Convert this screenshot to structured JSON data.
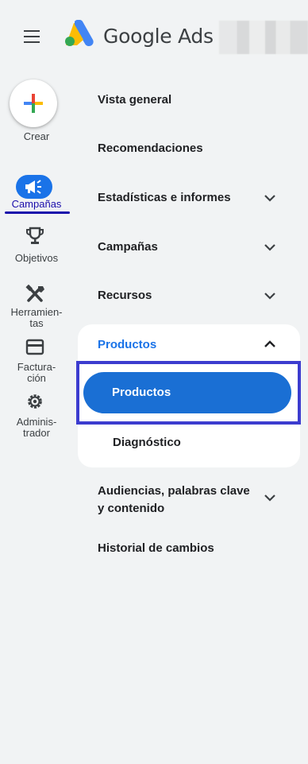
{
  "header": {
    "brand": "Google Ads"
  },
  "rail": {
    "create_label": "Crear",
    "items": [
      {
        "label": "Campañas",
        "icon": "megaphone-icon",
        "active": true
      },
      {
        "label": "Objetivos",
        "icon": "trophy-icon"
      },
      {
        "label_line1": "Herramien-",
        "label_line2": "tas",
        "icon": "tools-icon"
      },
      {
        "label_line1": "Factura-",
        "label_line2": "ción",
        "icon": "credit-card-icon"
      },
      {
        "label_line1": "Adminis-",
        "label_line2": "trador",
        "icon": "gear-icon"
      }
    ]
  },
  "menu": {
    "items": [
      {
        "label": "Vista general"
      },
      {
        "label": "Recomendaciones"
      },
      {
        "label": "Estadísticas e informes",
        "expandable": true
      },
      {
        "label": "Campañas",
        "expandable": true
      },
      {
        "label": "Recursos",
        "expandable": true
      },
      {
        "label": "Productos",
        "expanded": true,
        "children": [
          {
            "label": "Productos",
            "selected": true
          },
          {
            "label": "Diagnóstico"
          }
        ]
      },
      {
        "label_line1": "Audiencias, palabras clave",
        "label_line2": "y contenido",
        "expandable": true
      },
      {
        "label": "Historial de cambios"
      }
    ]
  },
  "colors": {
    "accent": "#1a73e8",
    "selected_pill": "#1a6fd4",
    "outline": "#3c3ccf",
    "background": "#f1f3f4"
  }
}
